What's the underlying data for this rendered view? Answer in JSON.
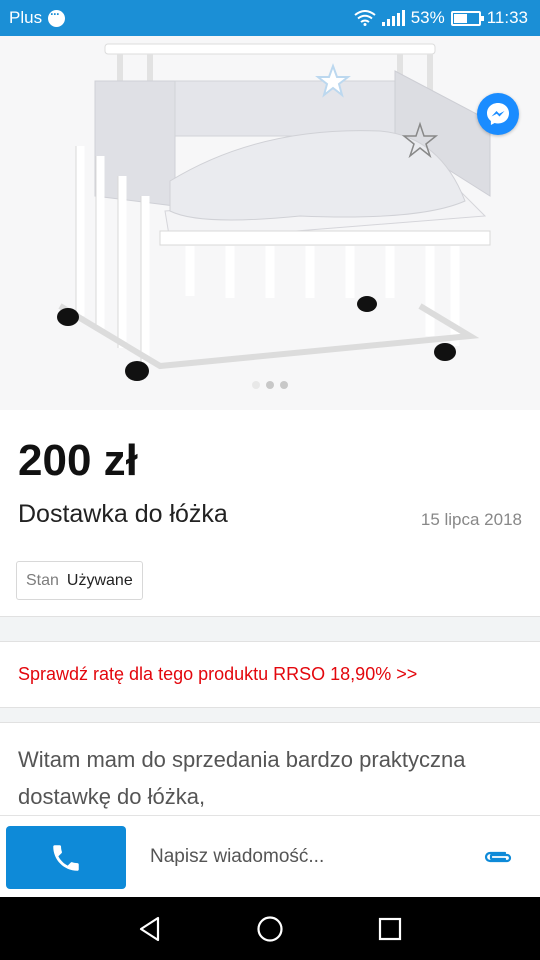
{
  "status_bar": {
    "carrier": "Plus",
    "battery": "53%",
    "battery_level": 0.53,
    "time": "11:33"
  },
  "gallery": {
    "image_count": 3,
    "active_index": 0,
    "image_alt": "Dostawka do łóżka"
  },
  "listing": {
    "price": "200 zł",
    "title": "Dostawka do łóżka",
    "date": "15 lipca 2018",
    "params": [
      {
        "key": "Stan",
        "value": "Używane"
      }
    ]
  },
  "credit": {
    "text": "Sprawdź ratę dla tego produktu RRSO 18,90% >>"
  },
  "description": {
    "text": "Witam mam do sprzedania bardzo praktyczna dostawkę do łóżka,"
  },
  "compose": {
    "placeholder": "Napisz wiadomość..."
  },
  "colors": {
    "status_bar": "#1b8fd6",
    "call_button": "#0e8ad8",
    "credit_text": "#e3070d",
    "messenger": "#1a8cff"
  },
  "icons": {
    "chat": "chat-bubble-icon",
    "wifi": "wifi-icon",
    "signal": "signal-icon",
    "battery": "battery-icon",
    "messenger": "messenger-icon",
    "call": "phone-icon",
    "attach": "paperclip-icon",
    "back": "back-triangle-icon",
    "home": "home-circle-icon",
    "recents": "recents-square-icon"
  }
}
